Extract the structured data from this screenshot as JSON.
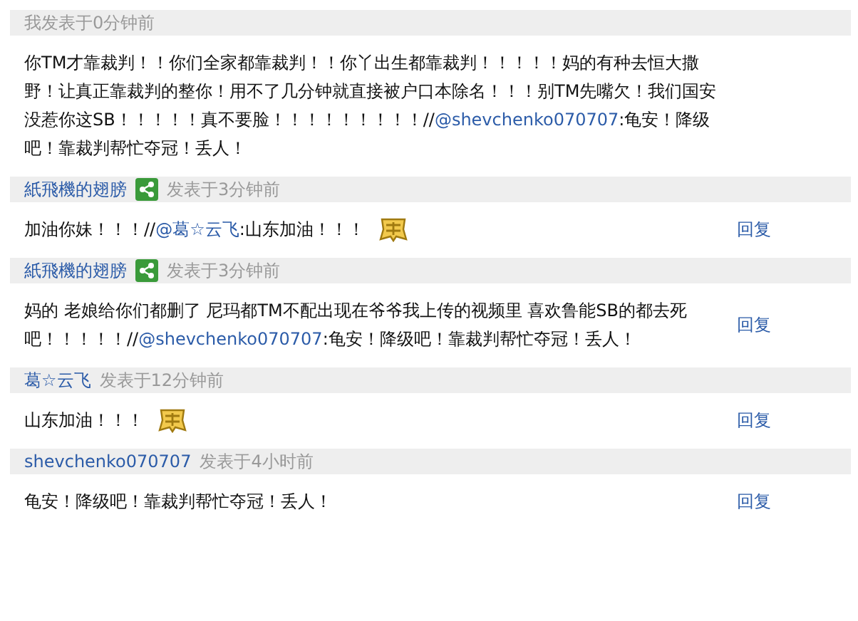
{
  "posts": [
    {
      "shared": false,
      "time": "我发表于0分钟前",
      "body": [
        {
          "kind": "text",
          "text": "你TM才靠裁判！！你们全家都靠裁判！！你丫出生都靠裁判！！！！！妈的有种去恒大撒野！让真正靠裁判的整你！用不了几分钟就直接被户口本除名！！！别TM先嘴欠！我们国安没惹你这SB！！！！！真不要脸！！！！！！！！！//"
        },
        {
          "kind": "mention",
          "text": "@shevchenko070707"
        },
        {
          "kind": "text",
          "text": ":龟安！降级吧！靠裁判帮忙夺冠！丢人！"
        }
      ],
      "emoticon": false
    },
    {
      "author": "紙飛機的翅膀",
      "shared": true,
      "time": "发表于3分钟前",
      "body": [
        {
          "kind": "text",
          "text": "加油你妹！！！//"
        },
        {
          "kind": "mention",
          "text": "@葛☆云飞"
        },
        {
          "kind": "text",
          "text": ":山东加油！！！"
        }
      ],
      "emoticon": true,
      "reply": "回复"
    },
    {
      "author": "紙飛機的翅膀",
      "shared": true,
      "time": "发表于3分钟前",
      "body": [
        {
          "kind": "text",
          "text": "妈的 老娘给你们都删了 尼玛都TM不配出现在爷爷我上传的视频里 喜欢鲁能SB的都去死吧！！！！！//"
        },
        {
          "kind": "mention",
          "text": "@shevchenko070707"
        },
        {
          "kind": "text",
          "text": ":龟安！降级吧！靠裁判帮忙夺冠！丢人！"
        }
      ],
      "emoticon": false,
      "reply": "回复"
    },
    {
      "author": "葛☆云飞",
      "shared": false,
      "time": "发表于12分钟前",
      "body": [
        {
          "kind": "text",
          "text": "山东加油！！！"
        }
      ],
      "emoticon": true,
      "reply": "回复"
    },
    {
      "author": "shevchenko070707",
      "shared": false,
      "time": "发表于4小时前",
      "body": [
        {
          "kind": "text",
          "text": "龟安！降级吧！靠裁判帮忙夺冠！丢人！"
        }
      ],
      "emoticon": false,
      "reply": "回复"
    }
  ]
}
